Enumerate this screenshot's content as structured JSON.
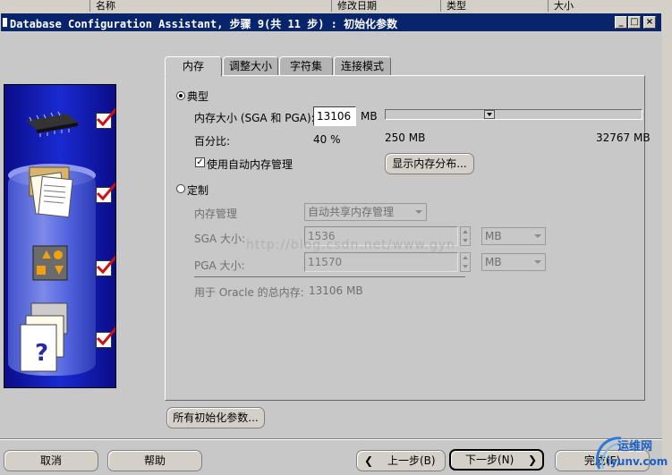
{
  "background_window": {
    "col1": "名称",
    "col2": "修改日期",
    "col3": "类型",
    "col4": "大小"
  },
  "window": {
    "title": "Database Configuration Assistant, 步骤 9(共 11 步) : 初始化参数",
    "min_label": "_",
    "max_label": "□",
    "close_label": "×"
  },
  "tabs": [
    "内存",
    "调整大小",
    "字符集",
    "连接模式"
  ],
  "typical": {
    "label": "典型",
    "selected": true,
    "memory_size_label": "内存大小 (SGA 和 PGA):",
    "memory_size_value": "13106",
    "memory_unit": "MB",
    "percentage_label": "百分比:",
    "percentage_value": "40 %",
    "slider_min": "250 MB",
    "slider_max": "32767 MB",
    "slider_level_percent": 40,
    "auto_memory_label": "使用自动内存管理",
    "auto_memory_checked": true,
    "auto_memory_check_glyph": "✓",
    "show_distribution_button": "显示内存分布..."
  },
  "custom": {
    "label": "定制",
    "selected": false,
    "memory_mgmt_label": "内存管理",
    "memory_mgmt_value": "自动共享内存管理",
    "sga_label": "SGA 大小:",
    "sga_value": "1536",
    "sga_unit": "MB",
    "pga_label": "PGA 大小:",
    "pga_value": "11570",
    "pga_unit": "MB",
    "total_label": "用于 Oracle 的总内存:",
    "total_value": "13106 MB"
  },
  "all_params_button": "所有初始化参数...",
  "footer": {
    "cancel": "取消",
    "help": "帮助",
    "back": "上一步(B)",
    "back_glyph": "❮",
    "next": "下一步(N)",
    "next_glyph": "❯",
    "finish": "完成(F)"
  },
  "watermark": {
    "url": "http://blog.csdn.net/www.gyn",
    "logo_text": "运维网",
    "logo_sub": "iyunv.com"
  },
  "colors": {
    "titlebar": "#08246b",
    "art_panel": "#1a2ad0",
    "check_red": "#d01010"
  }
}
